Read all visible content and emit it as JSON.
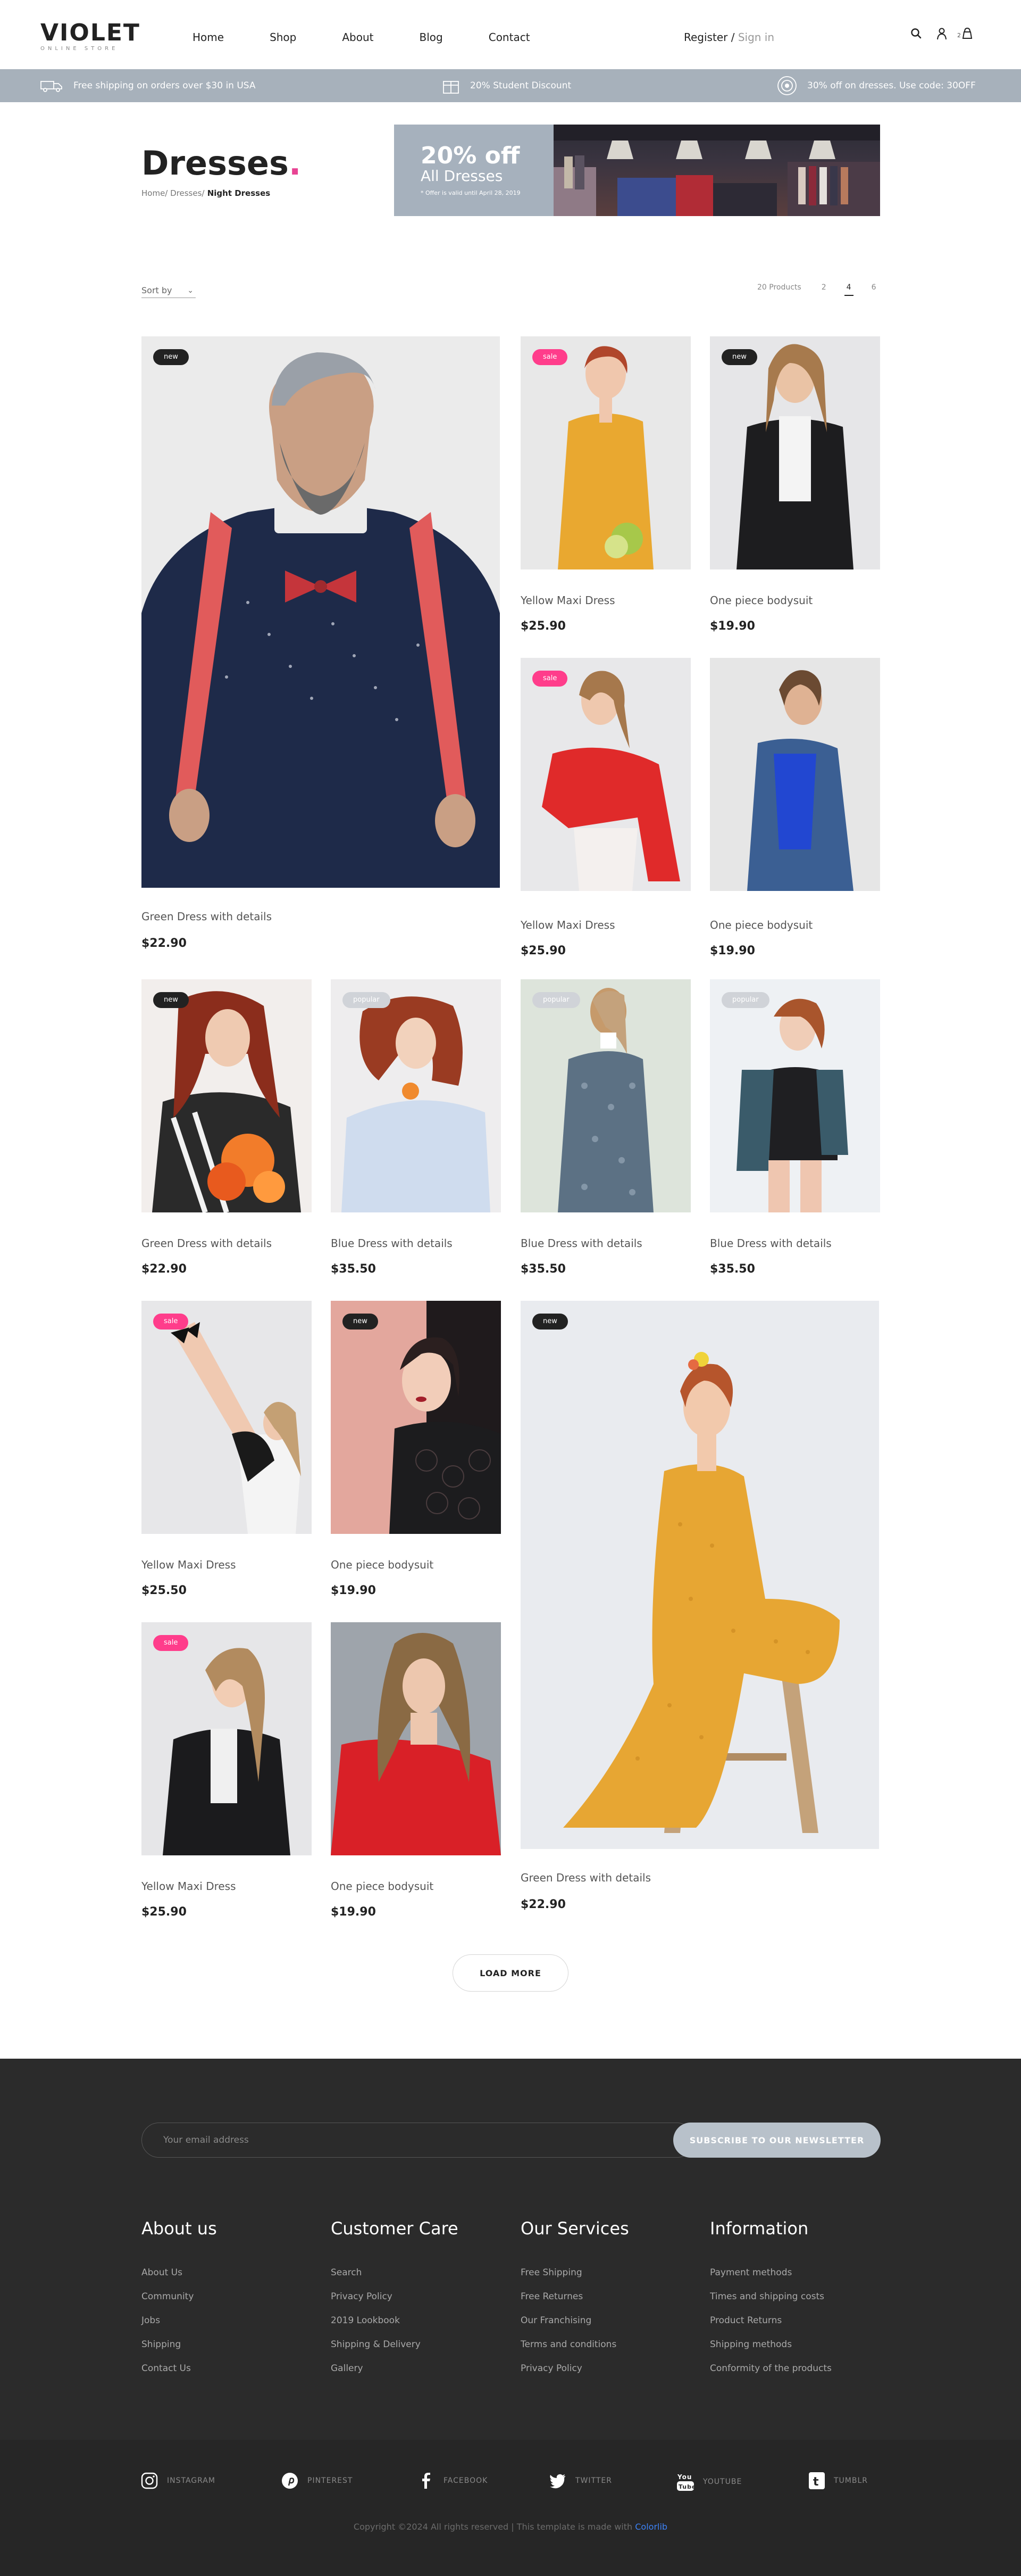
{
  "header": {
    "logo": "VIOLET",
    "logo_sub": "ONLINE STORE",
    "nav": [
      "Home",
      "Shop",
      "About",
      "Blog",
      "Contact"
    ],
    "register": "Register",
    "separator": "/",
    "sign_in": "Sign in",
    "icons": [
      "search-icon",
      "user-icon",
      "bag-icon"
    ],
    "cart_count": "2"
  },
  "topbar": {
    "shipping": "Free shipping on orders over $30 in USA",
    "student": "20% Student Discount",
    "dresses": "30% off on dresses. Use code: 30OFF"
  },
  "page": {
    "title": "Dresses",
    "title_dot": ".",
    "breadcrumb_home": "Home/",
    "breadcrumb_mid": " Dresses/",
    "breadcrumb_current": " Night Dresses"
  },
  "banner": {
    "headline": "20% off",
    "subline": "All Dresses",
    "note": "* Offer is valid until April 28, 2019"
  },
  "toolbar": {
    "sort_label": "Sort by",
    "sort_chevron": "⌄",
    "total": "20 Products",
    "pages": [
      "2",
      "4",
      "6"
    ],
    "active_page": "4"
  },
  "products": [
    {
      "name": "Green Dress with details",
      "price": "$22.90",
      "tag": "new"
    },
    {
      "name": "Yellow Maxi Dress",
      "price": "$25.90",
      "tag": "sale"
    },
    {
      "name": "One piece bodysuit",
      "price": "$19.90",
      "tag": "new"
    },
    {
      "name": "Yellow Maxi Dress",
      "price": "$25.90",
      "tag": "sale"
    },
    {
      "name": "One piece bodysuit",
      "price": "$19.90",
      "tag": ""
    },
    {
      "name": "Green Dress with details",
      "price": "$22.90",
      "tag": "new"
    },
    {
      "name": "Blue Dress with details",
      "price": "$35.50",
      "tag": "popular"
    },
    {
      "name": "Blue Dress with details",
      "price": "$35.50",
      "tag": "popular"
    },
    {
      "name": "Blue Dress with details",
      "price": "$35.50",
      "tag": "popular"
    },
    {
      "name": "Yellow Maxi Dress",
      "price": "$25.50",
      "tag": "sale"
    },
    {
      "name": "One piece bodysuit",
      "price": "$19.90",
      "tag": "new"
    },
    {
      "name": "Green Dress with details",
      "price": "$22.90",
      "tag": "new"
    },
    {
      "name": "Yellow Maxi Dress",
      "price": "$25.90",
      "tag": "sale"
    },
    {
      "name": "One piece bodysuit",
      "price": "$19.90",
      "tag": ""
    }
  ],
  "load_more": "LOAD MORE",
  "footer": {
    "newsletter_placeholder": "Your email address",
    "newsletter_button": "SUBSCRIBE TO OUR NEWSLETTER",
    "columns": [
      {
        "title": "About us",
        "links": [
          "About Us",
          "Community",
          "Jobs",
          "Shipping",
          "Contact Us"
        ]
      },
      {
        "title": "Customer Care",
        "links": [
          "Search",
          "Privacy Policy",
          "2019 Lookbook",
          "Shipping & Delivery",
          "Gallery"
        ]
      },
      {
        "title": "Our Services",
        "links": [
          "Free Shipping",
          "Free Returnes",
          "Our Franchising",
          "Terms and conditions",
          "Privacy Policy"
        ]
      },
      {
        "title": "Information",
        "links": [
          "Payment methods",
          "Times and shipping costs",
          "Product Returns",
          "Shipping methods",
          "Conformity of the products"
        ]
      }
    ],
    "social": [
      "INSTAGRAM",
      "PINTEREST",
      "FACEBOOK",
      "TWITTER",
      "YOUTUBE",
      "TUMBLR"
    ],
    "copyright": "Copyright ©2024 All rights reserved | This template is made with",
    "copyright_brand": "Colorlib"
  },
  "colors": {
    "accent": "#ff3d8b",
    "topbar": "#a7b1bb",
    "footer": "#2b2b2b"
  }
}
